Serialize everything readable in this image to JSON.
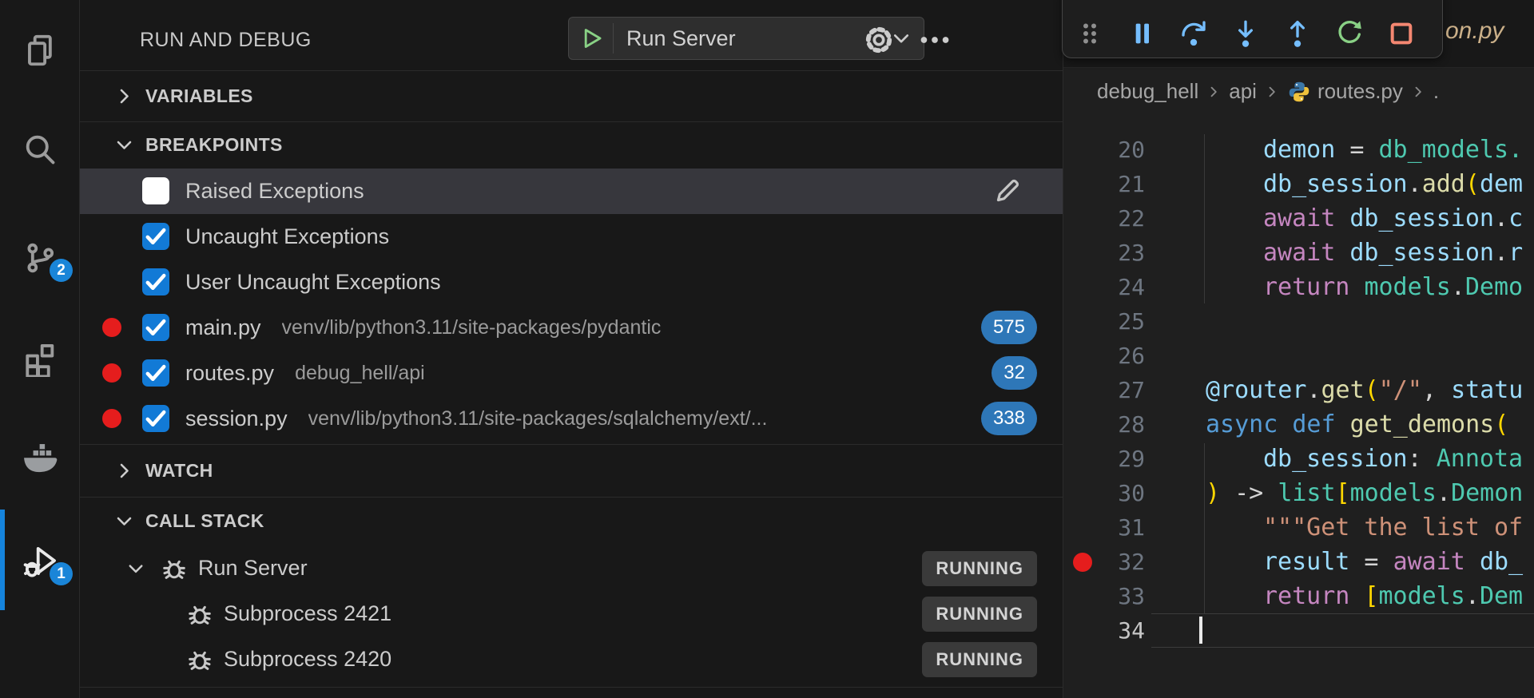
{
  "palette": {
    "activity_badge_blue": "#1a85d8",
    "active_indicator_blue": "#1584dd",
    "checkbox_blue": "#127ad6",
    "breakpoint_red": "#e51d1d",
    "count_badge_blue": "#2e77b8",
    "selected_row": "#37373d",
    "running_badge_bg": "#3a3a3a",
    "running_badge_text": "#d4d4d4",
    "play_green": "#89d185",
    "restart_green": "#89d185",
    "stop_red": "#f48771",
    "step_blue": "#75beff",
    "grip_gray": "#8f8f8f",
    "docker_gray": "#9a9da0",
    "icon_gray": "#9b9b9b",
    "icon_active": "#e9e9e9",
    "breadcrumb_text": "#a6a6a6",
    "line_number": "#6e7681",
    "line_number_active": "#c6c6c6",
    "tab_modified": "#cbb089",
    "code": {
      "var": "#9CDCFE",
      "kw": "#569CD6",
      "ctrl": "#C586C0",
      "fn": "#DCDCAA",
      "type": "#4EC9B0",
      "str": "#CE9178",
      "punct": "#D4D4D4",
      "bracket": "#FFD700"
    }
  },
  "activity_bar": {
    "items": [
      {
        "name": "explorer",
        "icon": "files"
      },
      {
        "name": "search",
        "icon": "search"
      },
      {
        "name": "source-control",
        "icon": "git",
        "badge": "2"
      },
      {
        "name": "extensions",
        "icon": "ext"
      },
      {
        "name": "docker",
        "icon": "docker"
      },
      {
        "name": "run-and-debug",
        "icon": "debugalt",
        "badge": "1",
        "active": true
      }
    ]
  },
  "sidebar": {
    "title": "RUN AND DEBUG",
    "launch_picker": {
      "label": "Run Server"
    },
    "sections": {
      "variables": {
        "label": "VARIABLES",
        "collapsed": true
      },
      "breakpoints": {
        "label": "BREAKPOINTS",
        "collapsed": false,
        "items": [
          {
            "label": "Raised Exceptions",
            "checked": false,
            "selected": true,
            "edit_icon": true
          },
          {
            "label": "Uncaught Exceptions",
            "checked": true
          },
          {
            "label": "User Uncaught Exceptions",
            "checked": true
          },
          {
            "label": "main.py",
            "path": "venv/lib/python3.11/site-packages/pydantic",
            "checked": true,
            "dot": true,
            "badge": "575"
          },
          {
            "label": "routes.py",
            "path": "debug_hell/api",
            "checked": true,
            "dot": true,
            "badge": "32"
          },
          {
            "label": "session.py",
            "path": "venv/lib/python3.11/site-packages/sqlalchemy/ext/...",
            "checked": true,
            "dot": true,
            "badge": "338"
          }
        ]
      },
      "watch": {
        "label": "WATCH",
        "collapsed": true
      },
      "call_stack": {
        "label": "CALL STACK",
        "collapsed": false,
        "threads": [
          {
            "label": "Run Server",
            "status": "RUNNING",
            "level": 0,
            "expanded": true
          },
          {
            "label": "Subprocess 2421",
            "status": "RUNNING",
            "level": 1
          },
          {
            "label": "Subprocess 2420",
            "status": "RUNNING",
            "level": 1
          }
        ]
      }
    }
  },
  "debug_toolbar": {
    "buttons": [
      {
        "name": "drag-handle",
        "icon": "grip",
        "color_key": "grip_gray"
      },
      {
        "name": "pause",
        "icon": "pause",
        "color_key": "step_blue"
      },
      {
        "name": "step-over",
        "icon": "stepover",
        "color_key": "step_blue"
      },
      {
        "name": "step-into",
        "icon": "stepinto",
        "color_key": "step_blue"
      },
      {
        "name": "step-out",
        "icon": "stepout",
        "color_key": "step_blue"
      },
      {
        "name": "restart",
        "icon": "restart",
        "color_key": "restart_green"
      },
      {
        "name": "stop",
        "icon": "stop",
        "color_key": "stop_red"
      }
    ]
  },
  "editor": {
    "partial_tab_label": "on.py",
    "breadcrumbs": [
      {
        "label": "debug_hell"
      },
      {
        "label": "api"
      },
      {
        "label": "routes.py",
        "icon": "python"
      },
      {
        "label": "."
      }
    ],
    "code": {
      "first_line": 20,
      "lines": [
        {
          "n": 20,
          "indent": 1,
          "tokens": [
            [
              "demon",
              "var"
            ],
            [
              " = ",
              "punct"
            ],
            [
              "db_models.",
              "type"
            ]
          ]
        },
        {
          "n": 21,
          "indent": 1,
          "tokens": [
            [
              "db_session",
              "var"
            ],
            [
              ".",
              "punct"
            ],
            [
              "add",
              "fn"
            ],
            [
              "(",
              "bracket"
            ],
            [
              "dem",
              "var"
            ]
          ]
        },
        {
          "n": 22,
          "indent": 1,
          "tokens": [
            [
              "await ",
              "ctrl"
            ],
            [
              "db_session",
              "var"
            ],
            [
              ".",
              "punct"
            ],
            [
              "c",
              "var"
            ]
          ]
        },
        {
          "n": 23,
          "indent": 1,
          "tokens": [
            [
              "await ",
              "ctrl"
            ],
            [
              "db_session",
              "var"
            ],
            [
              ".",
              "punct"
            ],
            [
              "r",
              "var"
            ]
          ]
        },
        {
          "n": 24,
          "indent": 1,
          "tokens": [
            [
              "return ",
              "ctrl"
            ],
            [
              "models",
              "type"
            ],
            [
              ".",
              "punct"
            ],
            [
              "Demo",
              "type"
            ]
          ]
        },
        {
          "n": 25,
          "indent": 0,
          "tokens": []
        },
        {
          "n": 26,
          "indent": 0,
          "tokens": []
        },
        {
          "n": 27,
          "indent": 0,
          "tokens": [
            [
              "@router",
              "var"
            ],
            [
              ".",
              "punct"
            ],
            [
              "get",
              "fn"
            ],
            [
              "(",
              "bracket"
            ],
            [
              "\"/\"",
              "str"
            ],
            [
              ", ",
              "punct"
            ],
            [
              "statu",
              "var"
            ]
          ]
        },
        {
          "n": 28,
          "indent": 0,
          "tokens": [
            [
              "async ",
              "kw"
            ],
            [
              "def ",
              "kw"
            ],
            [
              "get_demons",
              "fn"
            ],
            [
              "(",
              "bracket"
            ]
          ]
        },
        {
          "n": 29,
          "indent": 1,
          "tokens": [
            [
              "db_session",
              "var"
            ],
            [
              ": ",
              "punct"
            ],
            [
              "Annota",
              "type"
            ]
          ]
        },
        {
          "n": 30,
          "indent": 0,
          "tokens": [
            [
              ") ",
              "bracket"
            ],
            [
              "-> ",
              "punct"
            ],
            [
              "list",
              "type"
            ],
            [
              "[",
              "bracket"
            ],
            [
              "models",
              "type"
            ],
            [
              ".",
              "punct"
            ],
            [
              "Demon",
              "type"
            ]
          ]
        },
        {
          "n": 31,
          "indent": 1,
          "tokens": [
            [
              "\"\"\"Get the list of",
              "str"
            ]
          ]
        },
        {
          "n": 32,
          "indent": 1,
          "breakpoint": true,
          "tokens": [
            [
              "result",
              "var"
            ],
            [
              " = ",
              "punct"
            ],
            [
              "await ",
              "ctrl"
            ],
            [
              "db_",
              "var"
            ]
          ]
        },
        {
          "n": 33,
          "indent": 1,
          "tokens": [
            [
              "return ",
              "ctrl"
            ],
            [
              "[",
              "bracket"
            ],
            [
              "models",
              "type"
            ],
            [
              ".",
              "punct"
            ],
            [
              "Dem",
              "type"
            ]
          ]
        },
        {
          "n": 34,
          "indent": 0,
          "current": true,
          "tokens": []
        }
      ]
    }
  }
}
